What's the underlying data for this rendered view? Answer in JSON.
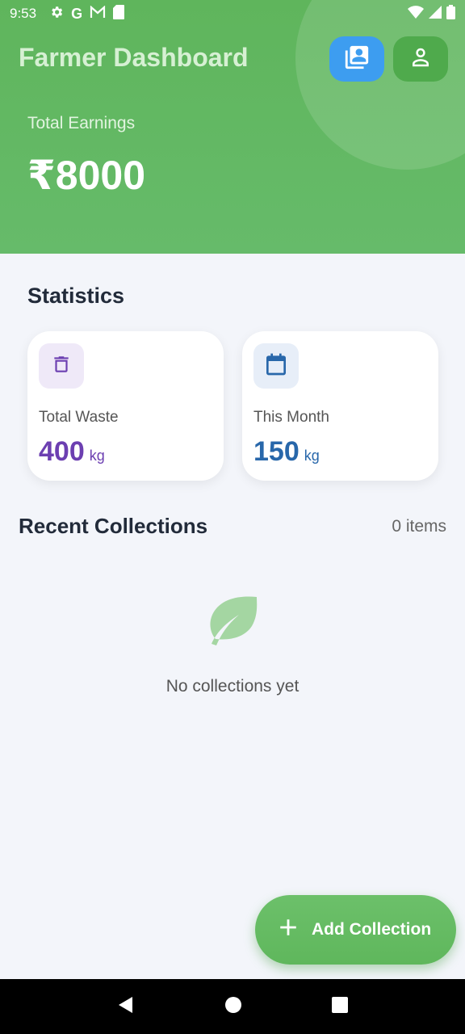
{
  "status": {
    "time": "9:53",
    "left_icons": [
      "settings-icon",
      "google-icon",
      "gmail-icon",
      "sd-card-icon"
    ],
    "right_icons": [
      "wifi-icon",
      "signal-icon",
      "battery-icon"
    ]
  },
  "header": {
    "title": "Farmer Dashboard",
    "earnings_label": "Total Earnings",
    "earnings_value": "₹8000",
    "buttons": [
      "collections-icon",
      "profile-icon"
    ],
    "colors": {
      "background": "#66bb6a",
      "blue_button": "#3d9df0",
      "green_button": "#4faa4c"
    }
  },
  "statistics": {
    "title": "Statistics",
    "cards": [
      {
        "label": "Total Waste",
        "value": "400",
        "unit": "kg",
        "icon": "trash-icon",
        "color": "#6c3fb1"
      },
      {
        "label": "This Month",
        "value": "150",
        "unit": "kg",
        "icon": "calendar-icon",
        "color": "#2867aa"
      }
    ]
  },
  "recent": {
    "title": "Recent Collections",
    "count": "0 items",
    "empty_text": "No collections yet",
    "empty_icon": "leaf-icon"
  },
  "fab": {
    "label": "Add Collection",
    "icon": "plus-icon"
  },
  "nav": [
    "back-icon",
    "home-icon",
    "recents-icon"
  ]
}
